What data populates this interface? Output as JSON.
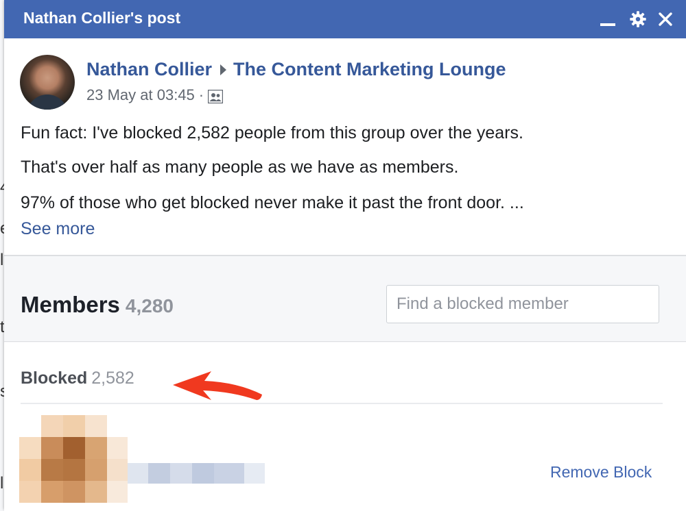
{
  "window": {
    "title": "Nathan Collier's post",
    "icons": [
      "minimize-icon",
      "gear-icon",
      "close-icon"
    ]
  },
  "post": {
    "author": "Nathan Collier",
    "group": "The Content Marketing Lounge",
    "timestamp": "23 May at 03:45",
    "separator": "·",
    "lines": [
      "Fun fact: I've blocked 2,582 people from this group over the years.",
      "That's over half as many people as we have as members.",
      "97% of those who get blocked never make it past the front door. ..."
    ],
    "see_more": "See more"
  },
  "embed": {
    "members_label": "Members",
    "members_count": "4,280",
    "search_placeholder": "Find a blocked member",
    "blocked_label": "Blocked",
    "blocked_count": "2,582",
    "remove_block": "Remove Block"
  },
  "background_fragments": [
    "4",
    "e",
    "l",
    "t",
    "s",
    "l"
  ],
  "colors": {
    "titlebar": "#4267b2",
    "link": "#365899",
    "annotation_arrow": "#f0391f"
  }
}
